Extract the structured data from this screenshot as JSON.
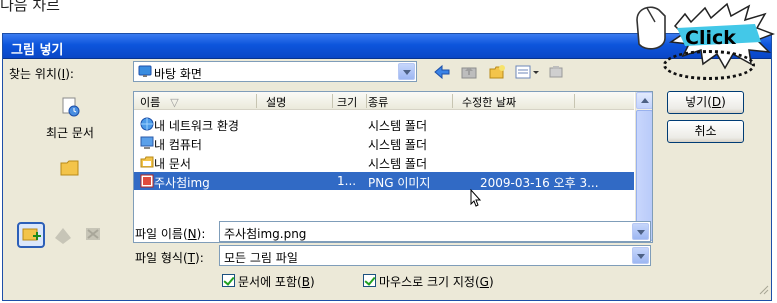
{
  "caption": "다음 차르",
  "window": {
    "title": "그림 넣기"
  },
  "lookin": {
    "label": "찾는 위치(",
    "hotkey": "I",
    "label_end": "):",
    "value": "바탕 화면"
  },
  "places": [
    {
      "label": "최근 문서"
    }
  ],
  "columns": {
    "name": "이름",
    "desc": "설명",
    "size": "크기",
    "type": "종류",
    "modified": "수정한 날짜"
  },
  "files": [
    {
      "name": "내 네트워크 환경",
      "size": "",
      "type": "시스템 폴더",
      "modified": ""
    },
    {
      "name": "내 컴퓨터",
      "size": "",
      "type": "시스템 폴더",
      "modified": ""
    },
    {
      "name": "내 문서",
      "size": "",
      "type": "시스템 폴더",
      "modified": ""
    },
    {
      "name": "주사첨img",
      "size": "1...",
      "type": "PNG 이미지",
      "modified": "2009-03-16 오후 3..."
    }
  ],
  "filename": {
    "label": "파일 이름(",
    "hotkey": "N",
    "label_end": "):",
    "value": "주사첨img.png"
  },
  "filetype": {
    "label": "파일 형식(",
    "hotkey": "T",
    "label_end": "):",
    "value": "모든 그림 파일"
  },
  "buttons": {
    "insert_label": "넣기(",
    "insert_hotkey": "D",
    "insert_end": ")",
    "cancel": "취소"
  },
  "options": {
    "link": {
      "label": "문서에 포함(",
      "hotkey": "B",
      "end": ")"
    },
    "resize": {
      "label": "마우스로 크기 지정(",
      "hotkey": "G",
      "end": ")"
    }
  },
  "callout": {
    "text": "Click"
  }
}
